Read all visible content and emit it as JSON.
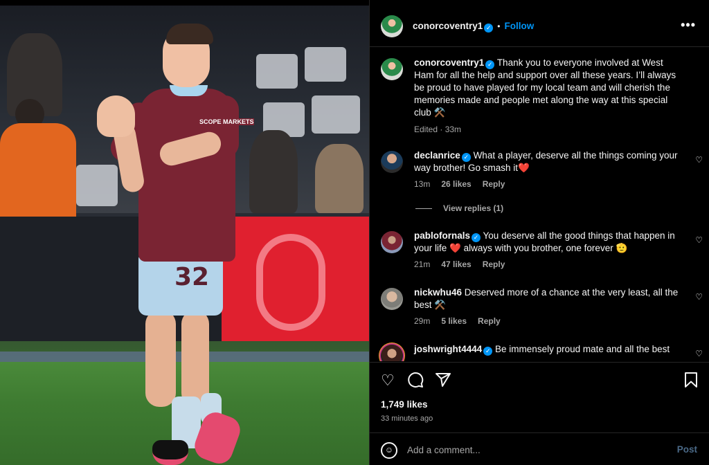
{
  "post": {
    "author": "conorcoventry1",
    "follow_label": "Follow",
    "more_label": "•••",
    "shorts_number": "32",
    "shirt_sponsor": "SCOPE MARKETS"
  },
  "caption": {
    "username": "conorcoventry1",
    "text": "Thank you to everyone involved at West Ham for all the help and support over all these years. I’ll always be proud to have played for my local team and will cherish the memories made and people met along the way at this special club ⚒️",
    "meta": "Edited · 33m"
  },
  "comments": [
    {
      "username": "declanrice",
      "verified": true,
      "text": "What a player, deserve all the things coming your way brother! Go smash it❤️",
      "time": "13m",
      "likes": "26 likes",
      "reply": "Reply"
    },
    {
      "username": "pablofornals",
      "verified": true,
      "text": "You deserve all the good things that happen in your life ❤️ always with you brother, one forever 🫡",
      "time": "21m",
      "likes": "47 likes",
      "reply": "Reply"
    },
    {
      "username": "nickwhu46",
      "verified": false,
      "text": "Deserved more of a chance at the very least, all the best ⚒️",
      "time": "29m",
      "likes": "5 likes",
      "reply": "Reply"
    },
    {
      "username": "joshwright4444",
      "verified": true,
      "text": "Be immensely proud mate and all the best",
      "time": "",
      "likes": "",
      "reply": ""
    }
  ],
  "view_replies": "View replies (1)",
  "actions": {
    "icons": [
      "heart-icon",
      "comment-icon",
      "share-icon",
      "bookmark-icon"
    ],
    "likes": "1,749 likes",
    "time_ago": "33 minutes ago"
  },
  "add_comment": {
    "placeholder": "Add a comment...",
    "post_label": "Post"
  },
  "colors": {
    "accent": "#0095f6",
    "background": "#000000",
    "muted": "#a8a8a8",
    "shirt": "#7a2433"
  }
}
